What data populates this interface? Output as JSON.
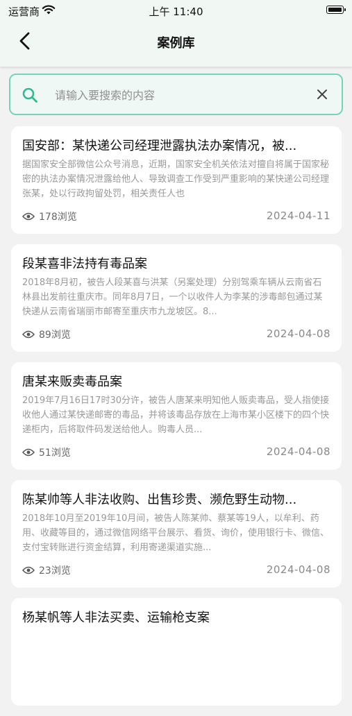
{
  "status": {
    "carrier": "运营商",
    "time": "上午 11:40"
  },
  "header": {
    "title": "案例库"
  },
  "search": {
    "placeholder": "请输入要搜索的内容"
  },
  "cases": [
    {
      "title": "国安部：某快递公司经理泄露执法办案情况，被...",
      "summary": "据国家安全部微信公众号消息，近期，国家安全机关依法对擅自将属于国家秘密的执法办案情况泄露给他人、导致调查工作受到严重影响的某快递公司经理张某，处以行政拘留处罚，相关责任人也",
      "views": "178浏览",
      "date": "2024-04-11"
    },
    {
      "title": "段某喜非法持有毒品案",
      "summary": "2018年8月初，被告人段某喜与洪某（另案处理）分别驾乘车辆从云南省石林县出发前往重庆市。同年8月7日，一个以收件人为李某的涉毒邮包通过某快递从云南省瑞丽市邮寄至重庆市九龙坡区。8...",
      "views": "89浏览",
      "date": "2024-04-08"
    },
    {
      "title": "唐某来贩卖毒品案",
      "summary": "2019年7月16日17时30分许，被告人唐某来明知他人贩卖毒品，受人指使接收他人通过某快递邮寄的毒品，并将该毒品存放在上海市某小区楼下的四个快递柜内，后将取件码发送给他人。购毒人员...",
      "views": "51浏览",
      "date": "2024-04-08"
    },
    {
      "title": "陈某帅等人非法收购、出售珍贵、濒危野生动物...",
      "summary": "2018年10月至2019年10月间，被告人陈某帅、蔡某等19人，以牟利、药用、收藏等目的，通过微信网络平台展示、看货、询价，使用银行卡、微信、支付宝转账进行资金结算，利用寄递渠道实施...",
      "views": "23浏览",
      "date": "2024-04-08"
    },
    {
      "title": "杨某帆等人非法买卖、运输枪支案",
      "summary": "",
      "views": "",
      "date": ""
    }
  ]
}
